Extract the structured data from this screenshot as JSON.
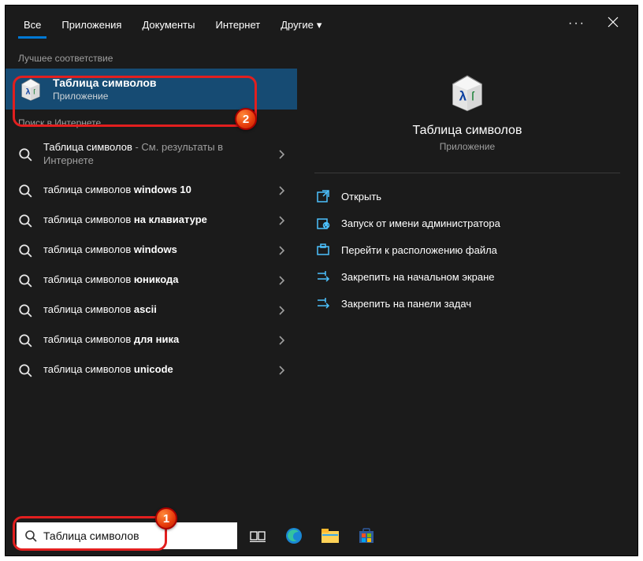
{
  "tabs": {
    "items": [
      "Все",
      "Приложения",
      "Документы",
      "Интернет",
      "Другие"
    ],
    "activeIndex": 0
  },
  "left": {
    "bestMatchLabel": "Лучшее соответствие",
    "bestMatch": {
      "title": "Таблица символов",
      "subtitle": "Приложение"
    },
    "webLabel": "Поиск в Интернете",
    "suggestions": [
      {
        "prefix": "Таблица символов",
        "suffix": " - См. результаты в Интернете"
      },
      {
        "prefix": "таблица символов ",
        "bold": "windows 10"
      },
      {
        "prefix": "таблица символов ",
        "bold": "на клавиатуре"
      },
      {
        "prefix": "таблица символов ",
        "bold": "windows"
      },
      {
        "prefix": "таблица символов ",
        "bold": "юникода"
      },
      {
        "prefix": "таблица символов ",
        "bold": "ascii"
      },
      {
        "prefix": "таблица символов ",
        "bold": "для ника"
      },
      {
        "prefix": "таблица символов ",
        "bold": "unicode"
      }
    ]
  },
  "preview": {
    "title": "Таблица символов",
    "subtitle": "Приложение",
    "actions": [
      {
        "label": "Открыть",
        "icon": "open"
      },
      {
        "label": "Запуск от имени администратора",
        "icon": "admin"
      },
      {
        "label": "Перейти к расположению файла",
        "icon": "folder"
      },
      {
        "label": "Закрепить на начальном экране",
        "icon": "pin"
      },
      {
        "label": "Закрепить на панели задач",
        "icon": "pin"
      }
    ]
  },
  "search": {
    "query": "Таблица символов"
  },
  "badges": {
    "one": "1",
    "two": "2"
  }
}
